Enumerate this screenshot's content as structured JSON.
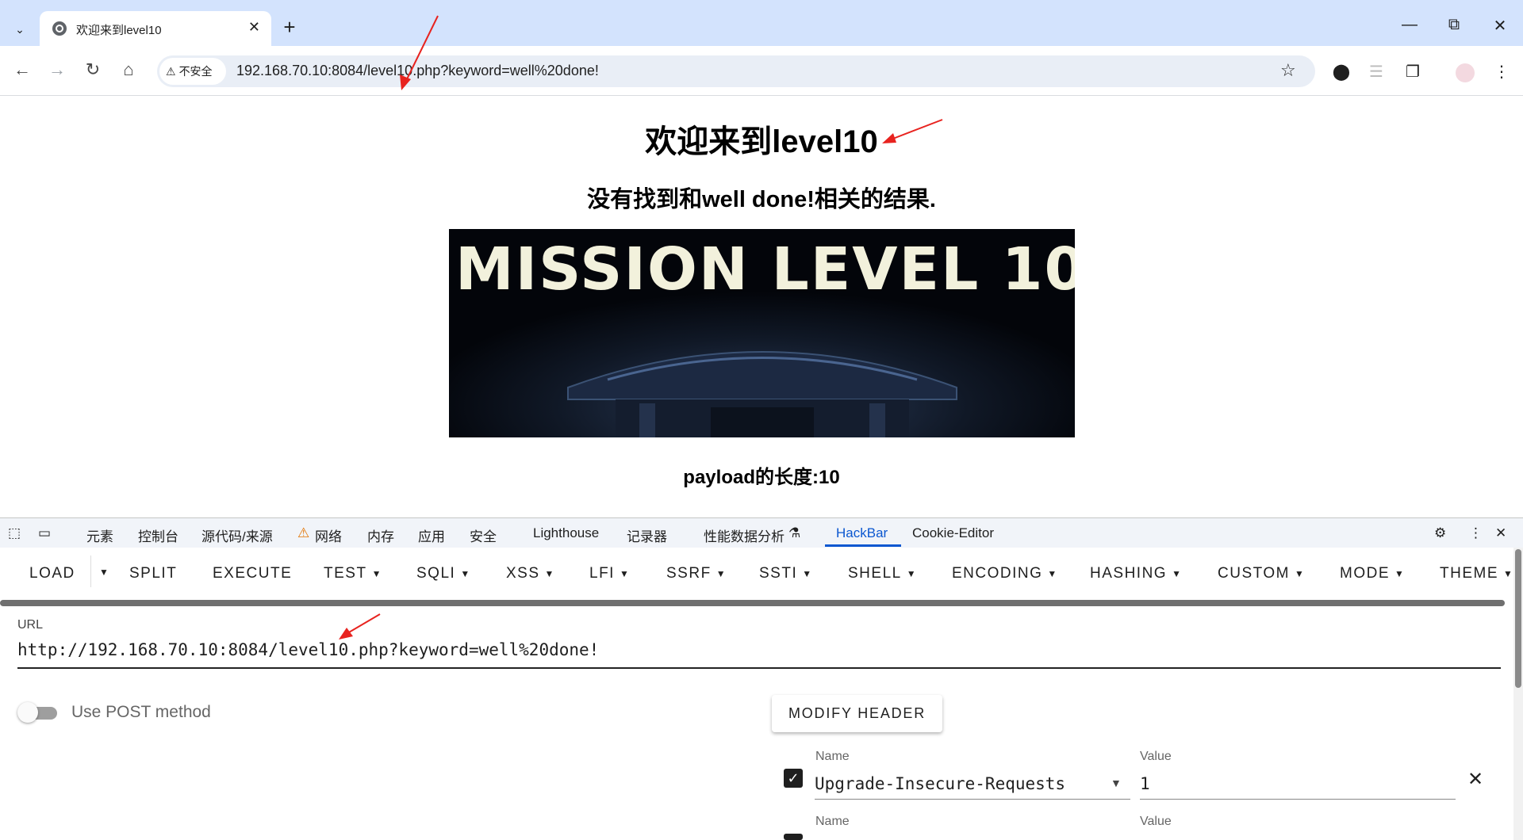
{
  "browser": {
    "tab_title": "欢迎来到level10",
    "security_label": "不安全",
    "address": "192.168.70.10:8084/level10.php?keyword=well%20done!"
  },
  "page": {
    "heading": "欢迎来到level10",
    "result_text": "没有找到和well done!相关的结果.",
    "banner_text": "MISSION LEVEL 10",
    "payload_length": "payload的长度:10"
  },
  "devtools": {
    "tabs": [
      "元素",
      "控制台",
      "源代码/来源",
      "网络",
      "内存",
      "应用",
      "安全",
      "Lighthouse",
      "记录器",
      "性能数据分析",
      "HackBar",
      "Cookie-Editor"
    ],
    "active_tab": "HackBar"
  },
  "hackbar": {
    "menu": [
      "LOAD",
      "SPLIT",
      "EXECUTE",
      "TEST",
      "SQLI",
      "XSS",
      "LFI",
      "SSRF",
      "SSTI",
      "SHELL",
      "ENCODING",
      "HASHING",
      "CUSTOM",
      "MODE",
      "THEME"
    ],
    "url_label": "URL",
    "url_value": "http://192.168.70.10:8084/level10.php?keyword=well%20done!",
    "post_toggle_label": "Use POST method",
    "post_enabled": false,
    "modify_header_label": "MODIFY HEADER",
    "headers": [
      {
        "name_label": "Name",
        "name": "Upgrade-Insecure-Requests",
        "value_label": "Value",
        "value": "1",
        "enabled": true
      },
      {
        "name_label": "Name",
        "value_label": "Value"
      }
    ]
  },
  "colors": {
    "tabstrip": "#d3e3fd",
    "omnibox": "#e9eef6",
    "accent": "#0b57d0",
    "annotation_arrow": "#e8231f"
  }
}
